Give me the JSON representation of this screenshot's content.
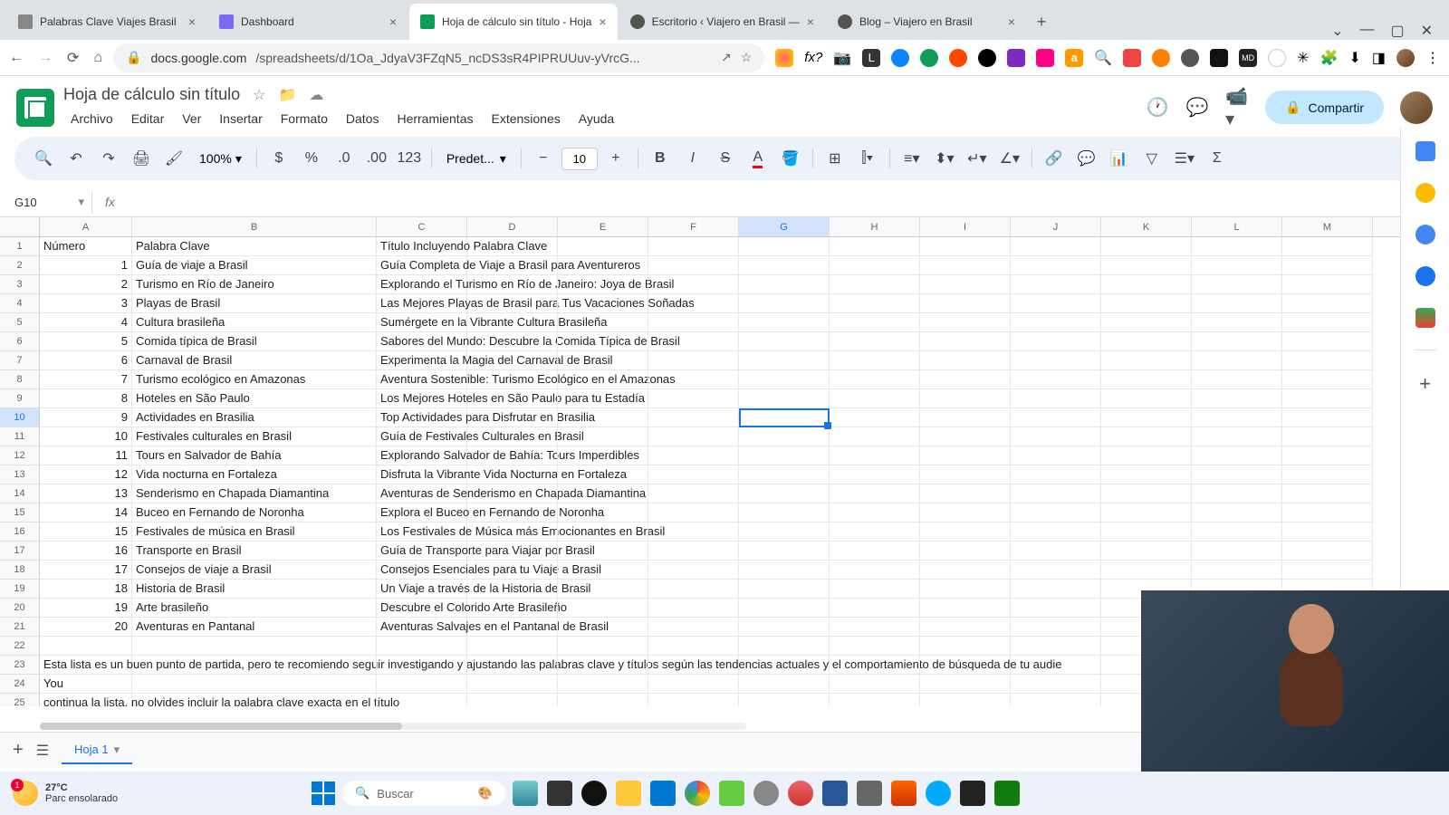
{
  "browser": {
    "tabs": [
      {
        "title": "Palabras Clave Viajes Brasil",
        "icon_color": "#888"
      },
      {
        "title": "Dashboard",
        "icon_color": "#7b68ee"
      },
      {
        "title": "Hoja de cálculo sin título - Hoja",
        "icon_color": "#0f9d58",
        "active": true
      },
      {
        "title": "Escritorio ‹ Viajero en Brasil —",
        "icon_color": "#555"
      },
      {
        "title": "Blog – Viajero en Brasil",
        "icon_color": "#555"
      }
    ],
    "url_prefix": "docs.google.com",
    "url_path": "/spreadsheets/d/1Oa_JdyaV3FZqN5_ncDS3sR4PIPRUUuv-yVrcG..."
  },
  "doc": {
    "title": "Hoja de cálculo sin título",
    "menubar": [
      "Archivo",
      "Editar",
      "Ver",
      "Insertar",
      "Formato",
      "Datos",
      "Herramientas",
      "Extensiones",
      "Ayuda"
    ],
    "share_label": "Compartir"
  },
  "toolbar": {
    "zoom": "100%",
    "font": "Predet...",
    "font_size": "10"
  },
  "namebox": "G10",
  "columns": [
    "A",
    "B",
    "C",
    "D",
    "E",
    "F",
    "G",
    "H",
    "I",
    "J",
    "K",
    "L",
    "M"
  ],
  "selected_col": "G",
  "selected_row": "10",
  "headers": {
    "A": "Número",
    "B": "Palabra Clave",
    "C": "Título Incluyendo Palabra Clave"
  },
  "data_rows": [
    {
      "n": "1",
      "b": "Guía de viaje a Brasil",
      "c": "Guía Completa de Viaje a Brasil para Aventureros"
    },
    {
      "n": "2",
      "b": "Turismo en Río de Janeiro",
      "c": "Explorando el Turismo en Río de Janeiro: Joya de Brasil"
    },
    {
      "n": "3",
      "b": "Playas de Brasil",
      "c": "Las Mejores Playas de Brasil para Tus Vacaciones Soñadas"
    },
    {
      "n": "4",
      "b": "Cultura brasileña",
      "c": "Sumérgete en la Vibrante Cultura Brasileña"
    },
    {
      "n": "5",
      "b": "Comida típica de Brasil",
      "c": "Sabores del Mundo: Descubre la Comida Típica de Brasil"
    },
    {
      "n": "6",
      "b": "Carnaval de Brasil",
      "c": "Experimenta la Magia del Carnaval de Brasil"
    },
    {
      "n": "7",
      "b": "Turismo ecológico en Amazonas",
      "c": "Aventura Sostenible: Turismo Ecológico en el Amazonas"
    },
    {
      "n": "8",
      "b": "Hoteles en São Paulo",
      "c": "Los Mejores Hoteles en São Paulo para tu Estadía"
    },
    {
      "n": "9",
      "b": "Actividades en Brasilia",
      "c": "Top Actividades para Disfrutar en Brasilia"
    },
    {
      "n": "10",
      "b": "Festivales culturales en Brasil",
      "c": "Guía de Festivales Culturales en Brasil"
    },
    {
      "n": "11",
      "b": "Tours en Salvador de Bahía",
      "c": "Explorando Salvador de Bahía: Tours Imperdibles"
    },
    {
      "n": "12",
      "b": "Vida nocturna en Fortaleza",
      "c": "Disfruta la Vibrante Vida Nocturna en Fortaleza"
    },
    {
      "n": "13",
      "b": "Senderismo en Chapada Diamantina",
      "c": "Aventuras de Senderismo en Chapada Diamantina"
    },
    {
      "n": "14",
      "b": "Buceo en Fernando de Noronha",
      "c": "Explora el Buceo en Fernando de Noronha"
    },
    {
      "n": "15",
      "b": "Festivales de música en Brasil",
      "c": "Los Festivales de Música más Emocionantes en Brasil"
    },
    {
      "n": "16",
      "b": "Transporte en Brasil",
      "c": "Guía de Transporte para Viajar por Brasil"
    },
    {
      "n": "17",
      "b": "Consejos de viaje a Brasil",
      "c": "Consejos Esenciales para tu Viaje a Brasil"
    },
    {
      "n": "18",
      "b": "Historia de Brasil",
      "c": "Un Viaje a través de la Historia de Brasil"
    },
    {
      "n": "19",
      "b": "Arte brasileño",
      "c": "Descubre el Colorido Arte Brasileño"
    },
    {
      "n": "20",
      "b": "Aventuras en Pantanal",
      "c": "Aventuras Salvajes en el Pantanal de Brasil"
    }
  ],
  "extra_rows": {
    "r23": "Esta lista es un buen punto de partida, pero te recomiendo seguir investigando y ajustando las palabras clave y títulos según las tendencias actuales y el comportamiento de búsqueda de tu audie",
    "r24": "You",
    "r25": "continua la lista, no olvides incluir la palabra clave exacta en el título"
  },
  "sheet_tab": "Hoja 1",
  "taskbar": {
    "temp": "27°C",
    "weather": "Parc ensolarado",
    "badge": "1",
    "search_placeholder": "Buscar"
  }
}
